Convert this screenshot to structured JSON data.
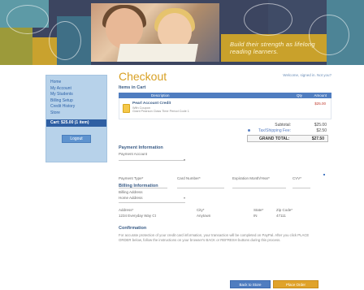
{
  "banner": {
    "tagline": "Build their strength as lifelong reading learners."
  },
  "sidebar": {
    "items": [
      {
        "label": "Home"
      },
      {
        "label": "My Account"
      },
      {
        "label": "My Students"
      },
      {
        "label": "Billing Setup"
      },
      {
        "label": "Credit History"
      },
      {
        "label": "Store"
      }
    ],
    "cart_label": "Cart: $25.00 (1 item)",
    "logout_label": "Logout"
  },
  "header": {
    "title": "Checkout",
    "welcome": "Welcome, signed in. Not you?"
  },
  "cart": {
    "section_title": "Items in Cart",
    "columns": [
      "Description",
      "Qty",
      "Amount"
    ],
    "items": [
      {
        "name": "Pearl Account Credit",
        "sub1": "With Coupon",
        "sub2": "Grant Pearson Class Time Period Code 1",
        "price": "$25.00"
      }
    ],
    "subtotal_label": "Subtotal:",
    "subtotal_value": "$25.00",
    "shipping_label": "Tax/Shipping Fee:",
    "shipping_value": "$2.50",
    "total_label": "GRAND TOTAL:",
    "total_value": "$27.50"
  },
  "payment": {
    "section_title": "Payment Information",
    "account_label": "Payment Account",
    "card_type_label": "Payment Type*",
    "card_number_label": "Card Number*",
    "expiration_label": "Expiration Month/Year*",
    "cvv_label": "CVV*"
  },
  "billing": {
    "section_title": "Billing Information",
    "address_label": "Billing Address",
    "address_value": "Home Address",
    "address_line_label": "Address*",
    "address_line_value": "1234 Everyday Way Ct",
    "city_label": "City*",
    "city_value": "Anytown",
    "state_label": "State*",
    "state_value": "IN",
    "zip_label": "Zip Code*",
    "zip_value": "47111"
  },
  "confirmation": {
    "section_title": "Confirmation",
    "text": "For accurate protection of your credit card information, your transaction will be completed on PayPal. After you click PLACE ORDER below, follow the instructions on your browser's BACK or REFRESH buttons during this process."
  },
  "actions": {
    "back_label": "Back to Store",
    "place_label": "Place Order"
  }
}
